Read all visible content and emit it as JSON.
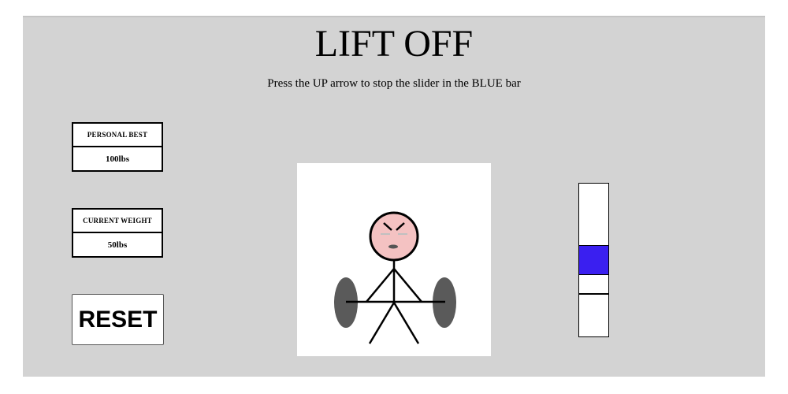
{
  "game": {
    "title": "LIFT OFF",
    "instructions": "Press the UP arrow to stop the slider in the BLUE bar"
  },
  "stats": {
    "personal_best_label": "PERSONAL BEST",
    "personal_best_value": "100lbs",
    "current_weight_label": "CURRENT WEIGHT",
    "current_weight_value": "50lbs"
  },
  "controls": {
    "reset_label": "RESET"
  },
  "meter": {
    "target_zone_top_fraction": 0.4,
    "target_zone_bottom_fraction": 0.6,
    "slider_position_fraction": 0.72,
    "target_color": "#3a1ff0"
  },
  "lifter": {
    "face_color": "#f4c2c2",
    "plate_color": "#5a5a5a"
  }
}
